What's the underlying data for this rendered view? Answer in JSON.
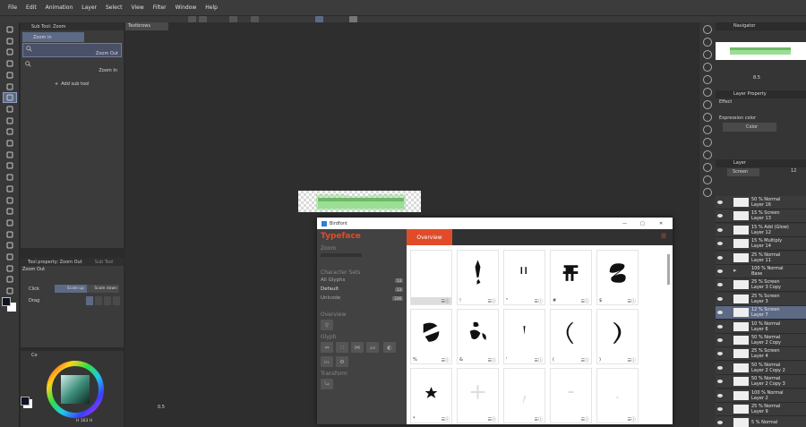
{
  "menu": [
    "File",
    "Edit",
    "Animation",
    "Layer",
    "Select",
    "View",
    "Filter",
    "Window",
    "Help"
  ],
  "subtool_panel": {
    "tab": "Sub Tool: Zoom",
    "group": "Zoom in",
    "items": [
      "Zoom Out",
      "Zoom In"
    ],
    "add_label": "Add sub tool"
  },
  "tool_property": {
    "tab1": "Tool property: Zoom Out",
    "tab2": "Sub Tool",
    "title": "Zoom Out",
    "click_label": "Click",
    "scale_up": "Scale up",
    "scale_down": "Scale down",
    "drag_label": "Drag"
  },
  "color_panel": {
    "tab": "Co",
    "hsv": "H 163 H",
    "fg_color": "#0e1424",
    "bg_color": "#ffffff"
  },
  "canvas": {
    "doc_tab": "Textbrows",
    "zoom": "0.5"
  },
  "navigator": {
    "tab": "Navigator",
    "zoom": "8.5"
  },
  "layer_property": {
    "tab": "Layer Property",
    "effect_label": "Effect",
    "expression_label": "Expression color",
    "expression_value": "Color"
  },
  "layer_panel": {
    "tab": "Layer",
    "blend": "Screen",
    "opacity": "12",
    "layers": [
      {
        "pct": "50 % Normal",
        "name": "Layer 16"
      },
      {
        "pct": "15 % Screen",
        "name": "Layer 13"
      },
      {
        "pct": "15 % Add (Glow)",
        "name": "Layer 12"
      },
      {
        "pct": "15 % Multiply",
        "name": "Layer 14"
      },
      {
        "pct": "25 % Normal",
        "name": "Layer 11"
      },
      {
        "pct": "100 % Normal",
        "name": "Base"
      },
      {
        "pct": "25 % Screen",
        "name": "Layer 3 Copy"
      },
      {
        "pct": "25 % Screen",
        "name": "Layer 3"
      },
      {
        "pct": "12 % Screen",
        "name": "Layer 7"
      },
      {
        "pct": "10 % Normal",
        "name": "Layer 6"
      },
      {
        "pct": "50 % Normal",
        "name": "Layer 2 Copy"
      },
      {
        "pct": "25 % Screen",
        "name": "Layer 4"
      },
      {
        "pct": "50 % Normal",
        "name": "Layer 2 Copy 2"
      },
      {
        "pct": "50 % Normal",
        "name": "Layer 2 Copy 3"
      },
      {
        "pct": "100 % Normal",
        "name": "Layer 2"
      },
      {
        "pct": "25 % Normal",
        "name": "Layer 9"
      },
      {
        "pct": "5 % Normal",
        "name": ""
      }
    ]
  },
  "birdfont": {
    "title": "Birdfont",
    "logo": "Typeface",
    "zoom_label": "Zoom",
    "charsets_label": "Character Sets",
    "charsets": [
      {
        "label": "All Glyphs",
        "count": "13"
      },
      {
        "label": "Default",
        "count": "13"
      },
      {
        "label": "Unicode",
        "count": "236"
      }
    ],
    "overview_label": "Overview",
    "glyph_label": "Glyph",
    "glyph_tool_labels": [
      "",
      "",
      "",
      "aal",
      "",
      "U+",
      ""
    ],
    "transform_label": "Transform",
    "tab": "Overview",
    "glyphs": [
      {
        "name": "",
        "shape": "none"
      },
      {
        "name": "!",
        "shape": "exclam"
      },
      {
        "name": "\"",
        "shape": "quote"
      },
      {
        "name": "#",
        "shape": "hash"
      },
      {
        "name": "$",
        "shape": "dollar"
      },
      {
        "name": "%",
        "shape": "percent"
      },
      {
        "name": "&",
        "shape": "amp"
      },
      {
        "name": "'",
        "shape": "apos"
      },
      {
        "name": "(",
        "shape": "lparen"
      },
      {
        "name": ")",
        "shape": "rparen"
      },
      {
        "name": "*",
        "shape": "star"
      },
      {
        "name": "",
        "shape": "plus"
      },
      {
        "name": "",
        "shape": "comma"
      },
      {
        "name": "",
        "shape": "minus"
      },
      {
        "name": "",
        "shape": "period"
      }
    ]
  }
}
